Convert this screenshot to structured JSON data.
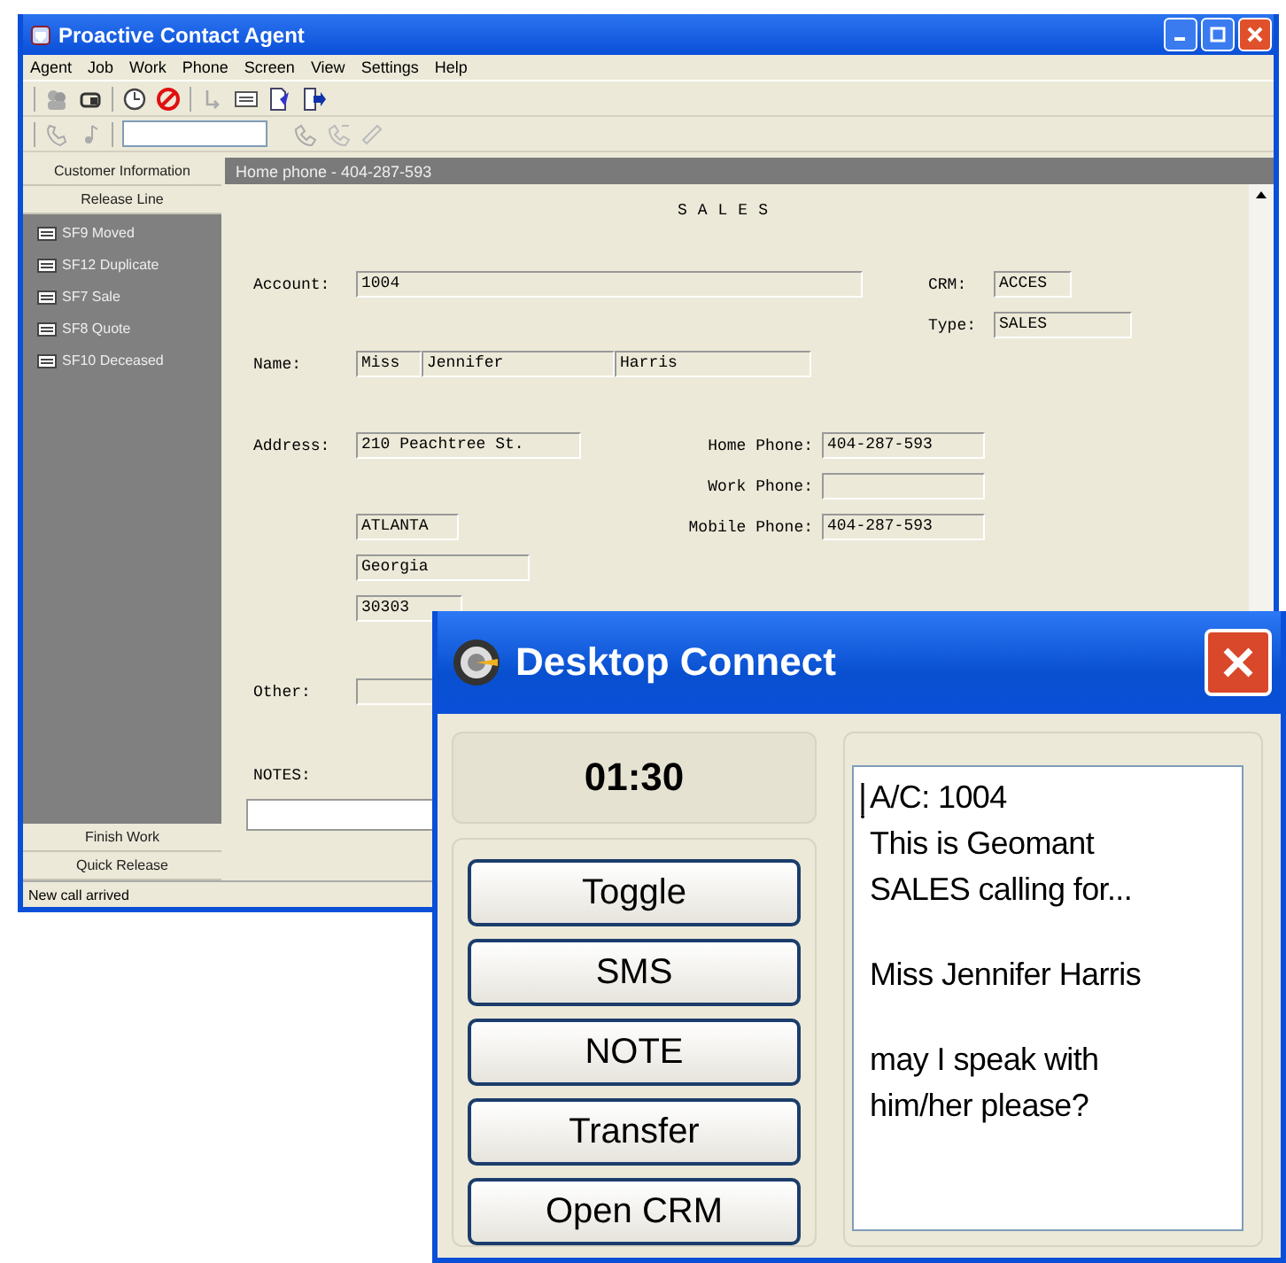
{
  "main_window": {
    "title": "Proactive Contact Agent",
    "menu": [
      "Agent",
      "Job",
      "Work",
      "Phone",
      "Screen",
      "View",
      "Settings",
      "Help"
    ],
    "sidebar": {
      "tabs": [
        "Customer Information",
        "Release Line"
      ],
      "items": [
        "SF9 Moved",
        "SF12 Duplicate",
        "SF7 Sale",
        "SF8 Quote",
        "SF10 Deceased"
      ],
      "bottom_buttons": [
        "Finish Work",
        "Quick Release"
      ]
    },
    "content": {
      "header": "Home phone - 404-287-593",
      "heading": "SALES",
      "account": {
        "label": "Account:",
        "value": "1004"
      },
      "crm": {
        "label": "CRM:",
        "value": "ACCES"
      },
      "type": {
        "label": "Type:",
        "value": "SALES"
      },
      "name": {
        "label": "Name:",
        "title": "Miss",
        "first": "Jennifer",
        "last": "Harris"
      },
      "address": {
        "label": "Address:",
        "lines": [
          "210 Peachtree St.",
          "ATLANTA",
          "Georgia",
          "30303"
        ]
      },
      "phones": [
        {
          "label": "Home Phone:",
          "value": "404-287-593"
        },
        {
          "label": "Work Phone:"
        },
        {
          "label": "Mobile Phone:",
          "value": "404-287-593"
        }
      ],
      "other": {
        "label": "Other:"
      },
      "notes": {
        "label": "NOTES:"
      }
    },
    "status_bar": "New call arrived"
  },
  "dialog": {
    "title": "Desktop Connect",
    "timer": "01:30",
    "buttons": [
      "Toggle",
      "SMS",
      "NOTE",
      "Transfer",
      "Open CRM"
    ],
    "message": [
      "A/C: 1004\nThis is Geomant\nSALES calling for...",
      "Miss Jennifer Harris",
      "may I speak with\nhim/her please?"
    ]
  }
}
